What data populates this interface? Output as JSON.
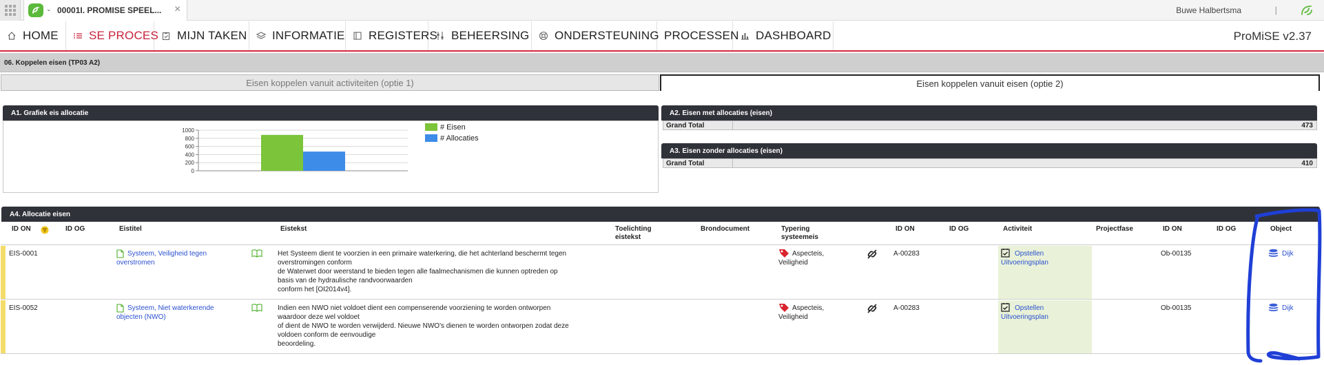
{
  "topbar": {
    "tab_title": "00001I. PROMISE SPEEL...",
    "close_glyph": "×",
    "chevron_glyph": "⌄",
    "user_name": "Buwe Halbertsma",
    "separator": "|"
  },
  "nav": {
    "items": [
      {
        "label": "HOME",
        "icon": "home-icon",
        "active": false
      },
      {
        "label": "SE PROCES",
        "icon": "list-icon",
        "active": true
      },
      {
        "label": "MIJN TAKEN",
        "icon": "clipboard-icon",
        "active": false
      },
      {
        "label": "INFORMATIE",
        "icon": "layers-icon",
        "active": false
      },
      {
        "label": "REGISTERS",
        "icon": "book-icon",
        "active": false
      },
      {
        "label": "BEHEERSING",
        "icon": "sliders-icon",
        "active": false
      },
      {
        "label": "ONDERSTEUNING",
        "icon": "lifebuoy-icon",
        "active": false
      },
      {
        "label": "PROCESSEN",
        "icon": "",
        "active": false
      },
      {
        "label": "DASHBOARD",
        "icon": "bar-chart-icon",
        "active": false
      }
    ],
    "version": "ProMiSE v2.37",
    "accent_color": "#c8223a"
  },
  "page": {
    "title": "06. Koppelen eisen (TP03 A2)",
    "tabs": [
      "Eisen koppelen vanuit activiteiten (optie 1)",
      "Eisen koppelen vanuit eisen (optie 2)"
    ],
    "active_tab": 1
  },
  "panels": {
    "a1_title": "A1. Grafiek eis allocatie",
    "a2_title": "A2. Eisen met allocaties (eisen)",
    "a2_label": "Grand Total",
    "a2_value": "473",
    "a3_title": "A3. Eisen zonder allocaties (eisen)",
    "a3_label": "Grand Total",
    "a3_value": "410",
    "a4_title": "A4. Allocatie eisen"
  },
  "chart_data": {
    "type": "bar",
    "categories": [
      ""
    ],
    "series": [
      {
        "name": "# Eisen",
        "values": [
          883
        ],
        "color": "#7cc43a"
      },
      {
        "name": "# Allocaties",
        "values": [
          473
        ],
        "color": "#3d8ce8"
      }
    ],
    "y_ticks": [
      "0",
      "200",
      "400",
      "600",
      "800",
      "1000"
    ],
    "ylim": [
      0,
      1000
    ],
    "legend": "right",
    "grid": true
  },
  "table": {
    "headers": {
      "id_on": "ID ON",
      "id_og": "ID OG",
      "eistitel": "Eistitel",
      "eistekst": "Eistekst",
      "toelichting": [
        "Toelichting",
        "eistekst"
      ],
      "brondocument": "Brondocument",
      "typering": [
        "Typering",
        "systeemeis"
      ],
      "id_on2": "ID ON",
      "id_og2": "ID OG",
      "activiteit": "Activiteit",
      "projectfase": "Projectfase",
      "id_on3": "ID ON",
      "id_og3": "ID OG",
      "object": "Object"
    },
    "rows": [
      {
        "id": "EIS-0001",
        "title": [
          "Systeem, Veiligheid tegen",
          "overstromen"
        ],
        "text": [
          "Het Systeem dient te voorzien in een primaire waterkering, die het achterland beschermt tegen",
          "overstromingen conform",
          "de Waterwet door weerstand te bieden tegen alle faalmechanismen die kunnen optreden op",
          "basis van de hydraulische randvoorwaarden",
          "conform het [OI2014v4]."
        ],
        "typering": [
          "Aspecteis,",
          "Veiligheid"
        ],
        "activity_id": "A-00283",
        "activity": [
          "Opstellen",
          "Uitvoeringsplan"
        ],
        "object_id": "Ob-00135",
        "object": "Dijk"
      },
      {
        "id": "EIS-0052",
        "title": [
          "Systeem, Niet waterkerende",
          "objecten (NWO)"
        ],
        "text": [
          "Indien een NWO niet voldoet dient een compenserende voorziening te worden ontworpen",
          "waardoor deze wel voldoet",
          "of dient de NWO te worden verwijderd. Nieuwe NWO's dienen te worden ontworpen zodat deze",
          "voldoen conform de eenvoudige",
          "beoordeling."
        ],
        "typering": [
          "Aspecteis,",
          "Veiligheid"
        ],
        "activity_id": "A-00283",
        "activity": [
          "Opstellen",
          "Uitvoeringsplan"
        ],
        "object_id": "Ob-00135",
        "object": "Dijk"
      }
    ]
  },
  "colors": {
    "panel_header": "#30323a",
    "activity_bg": "#e9f2d8",
    "link": "#2a4fd0",
    "annotation": "#1f3fd6",
    "row_flag": "#f2dc6a",
    "tag_red": "#d9232e"
  }
}
